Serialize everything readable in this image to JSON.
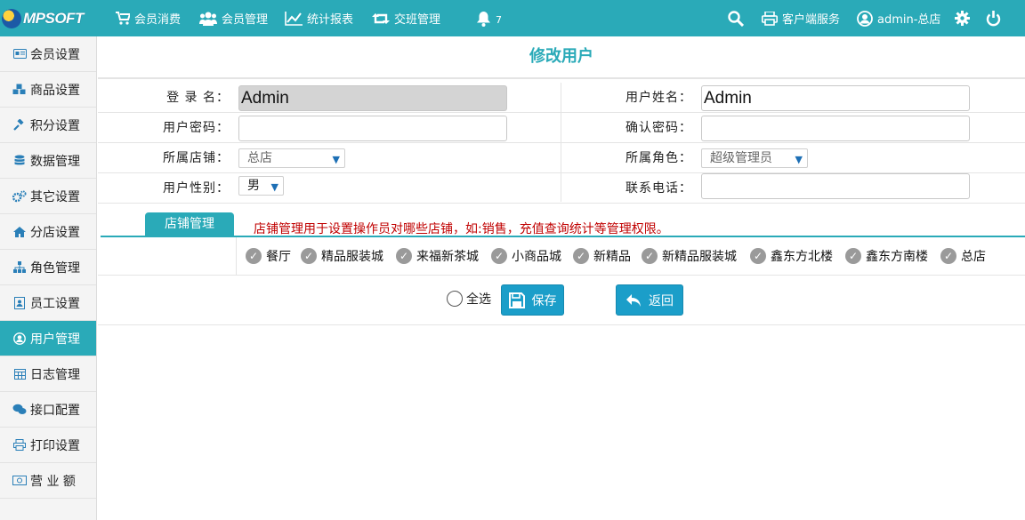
{
  "app": {
    "logo": "MPSOFT"
  },
  "topnav": {
    "items": [
      {
        "icon": "cart-icon",
        "label": "会员消费"
      },
      {
        "icon": "users-icon",
        "label": "会员管理"
      },
      {
        "icon": "chart-line-icon",
        "label": "统计报表"
      },
      {
        "icon": "retweet-icon",
        "label": "交班管理"
      }
    ],
    "bell": {
      "icon": "bell-icon",
      "count": "7"
    },
    "search": {
      "icon": "search-icon"
    },
    "client_service": {
      "icon": "printer-icon",
      "label": "客户端服务"
    },
    "user": {
      "icon": "user-circle-icon",
      "label": "admin-总店"
    },
    "settings": {
      "icon": "gear-icon"
    },
    "power": {
      "icon": "power-icon"
    }
  },
  "sidebar": {
    "items": [
      {
        "icon": "id-card-icon",
        "label": "会员设置",
        "active": false
      },
      {
        "icon": "cubes-icon",
        "label": "商品设置",
        "active": false
      },
      {
        "icon": "gavel-icon",
        "label": "积分设置",
        "active": false
      },
      {
        "icon": "database-icon",
        "label": "数据管理",
        "active": false
      },
      {
        "icon": "cogs-icon",
        "label": "其它设置",
        "active": false
      },
      {
        "icon": "home-icon",
        "label": "分店设置",
        "active": false
      },
      {
        "icon": "sitemap-icon",
        "label": "角色管理",
        "active": false
      },
      {
        "icon": "badge-icon",
        "label": "员工设置",
        "active": false
      },
      {
        "icon": "user-circle-icon",
        "label": "用户管理",
        "active": true
      },
      {
        "icon": "calendar-icon",
        "label": "日志管理",
        "active": false
      },
      {
        "icon": "chat-icon",
        "label": "接口配置",
        "active": false
      },
      {
        "icon": "print-icon",
        "label": "打印设置",
        "active": false
      },
      {
        "icon": "money-icon",
        "label": "营 业 额",
        "active": false
      }
    ]
  },
  "page": {
    "title": "修改用户",
    "form": {
      "login_name": {
        "label": "登 录 名：",
        "value": "Admin"
      },
      "user_name": {
        "label": "用户姓名：",
        "value": "Admin"
      },
      "password": {
        "label": "用户密码：",
        "value": ""
      },
      "confirm_password": {
        "label": "确认密码：",
        "value": ""
      },
      "store": {
        "label": "所属店铺：",
        "value": "总店"
      },
      "role": {
        "label": "所属角色：",
        "value": "超级管理员"
      },
      "gender": {
        "label": "用户性别：",
        "value": "男"
      },
      "phone": {
        "label": "联系电话：",
        "value": ""
      }
    },
    "store_mgmt": {
      "tab": "店铺管理",
      "note": "店铺管理用于设置操作员对哪些店铺，如:销售，充值查询统计等管理权限。",
      "stores": [
        "餐厅",
        "精品服装城",
        "来福新茶城",
        "小商品城",
        "新精品",
        "新精品服装城",
        "鑫东方北楼",
        "鑫东方南楼",
        "总店"
      ]
    },
    "actions": {
      "select_all": "全选",
      "save": "保存",
      "back": "返回"
    }
  },
  "colors": {
    "accent": "#2aaab8",
    "button": "#1b9ec9",
    "note": "#c00000"
  }
}
